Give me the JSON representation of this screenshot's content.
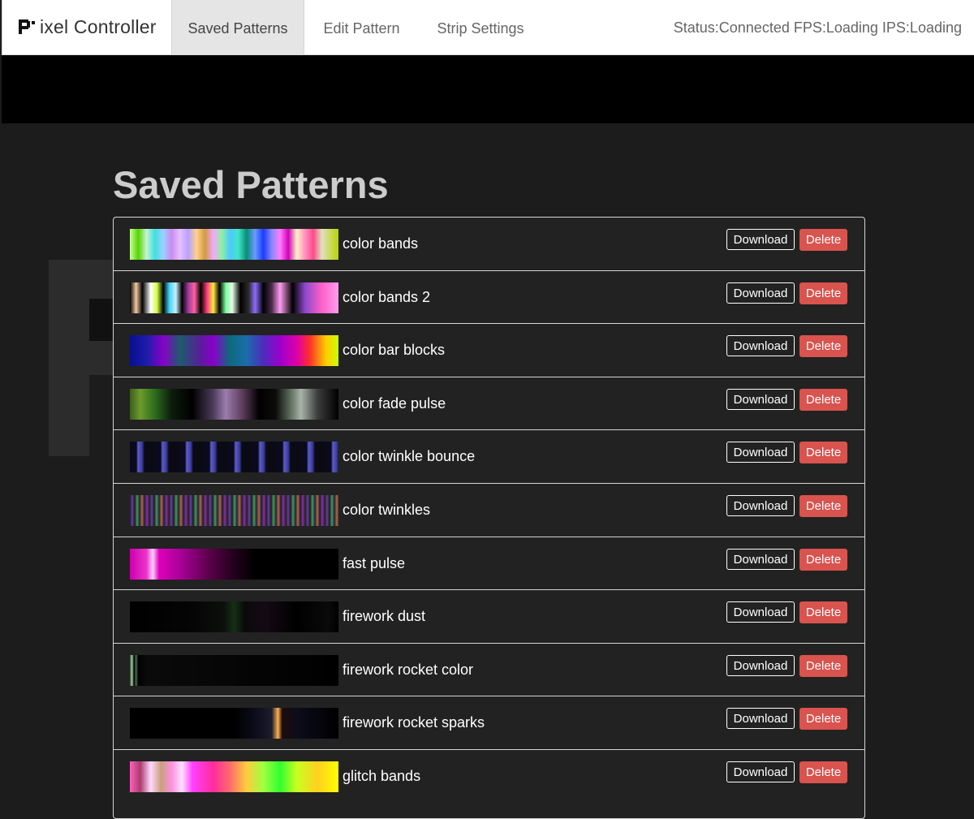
{
  "app": {
    "brand": "ixel Controller"
  },
  "nav": {
    "tabs": [
      {
        "label": "Saved Patterns"
      },
      {
        "label": "Edit Pattern"
      },
      {
        "label": "Strip Settings"
      }
    ],
    "status": "Status:Connected FPS:Loading IPS:Loading"
  },
  "page": {
    "title": "Saved Patterns"
  },
  "buttons": {
    "download": "Download",
    "delete": "Delete"
  },
  "colors": {
    "delete_button": "#d9534f",
    "background": "#1c1c1c",
    "list_background": "#222222"
  },
  "patterns": [
    {
      "name": "color bands",
      "gradient": "linear-gradient(to right,#c9ffa0 0%,#55d400 4%,#c7f4d2 8%,#3ee0e0 12%,#9dd1ff 16%,#c98cf0 20%,#e6c0ff 24%,#b8a0ff 28%,#ffd28a 32%,#d19b40 36%,#f4a7ff 40%,#90f0a0 44%,#50c8ff 48%,#40e6c6 52%,#0a8c7a 56%,#6a9cff 60%,#1c3cff 64%,#8888ff 68%,#ff7cff 72%,#d000b8 76%,#fff2c8 80%,#ff90c0 84%,#ff4a8a 88%,#e0e0c0 92%,#b8d400 100%)"
    },
    {
      "name": "color bands 2",
      "gradient": "linear-gradient(to right,#000 0%,#f2c8a0 3%,#000 6%,#fff 10%,#d0ff40 13%,#000 16%,#44d4ff 19%,#c8f0ff 22%,#000 25%,#9c3c9c 28%,#ff60a0 31%,#000 34%,#ff3c7c 37%,#ffea40 40%,#000 43%,#78ff9c 46%,#e8ffe8 49%,#000 53%,#2c2c2c 57%,#8c6cff 60%,#000 64%,#4c2c4c 68%,#ff9cf0 72%,#000 78%,#8c48cc 84%,#ff60c8 92%,#ff9cf0 100%)"
    },
    {
      "name": "color bar blocks",
      "gradient": "linear-gradient(to right,#08108c 0%,#1c1caa 8%,#8800c8 16%,#1c5c6c 24%,#5c1c9c 34%,#8800cc 40%,#0c6c7c 48%,#1c6cac 56%,#4c2cbc 64%,#9c00cc 72%,#dd00aa 80%,#ff2c2c 86%,#ffcc00 94%,#ccff00 100%)"
    },
    {
      "name": "color fade pulse",
      "gradient": "linear-gradient(to right,#3c5c1c 0%,#6c9c2c 5%,#2c6c1c 12%,#0c1c0c 20%,#000 30%,#4c3c5c 40%,#9c7cac 46%,#5c3c5c 54%,#000 62%,#0c0c0c 70%,#6c7c6c 78%,#aab4aa 82%,#3c3c3c 90%,#000 100%)"
    },
    {
      "name": "color twinkle bounce",
      "gradient": "repeating-linear-gradient(to right,#0a0a1c 0px,#0a0a1c 8px,#5c5ccc 10px,#3c3c9c 15px,#0a0a14 18px,#0a0a14 30px)"
    },
    {
      "name": "color twinkles",
      "gradient": "repeating-linear-gradient(to right,#1c1c2c 0px,#6c3c9c 3px,#1c1c1c 6px,#3c9c5c 9px,#2c1c3c 12px,#aa6c3c 15px,#1c1c3c 18px,#8c2c9c 21px,#1c2c1c 24px)"
    },
    {
      "name": "fast pulse",
      "gradient": "linear-gradient(to right,#cc00aa 0%,#ee33cc 8%,#ffd0ff 11%,#dd00bb 14%,#aa0099 24%,#660055 36%,#2a0022 48%,#000 60%,#000 100%)"
    },
    {
      "name": "firework dust",
      "gradient": "linear-gradient(to right,#000 0%,#050505 30%,#0c0f0c 45%,#143014 50%,#0a0a0a 55%,#140a14 65%,#000 80%,#0a0a0a 95%,#000 100%)"
    },
    {
      "name": "firework rocket color",
      "gradient": "linear-gradient(to right,#2c4c2c 0%,#aaccaa 1%,#000 2%,#4c6c4c 3%,#000 4%,#0a0a0a 8%,#000 100%)"
    },
    {
      "name": "firework rocket sparks",
      "gradient": "linear-gradient(to right,#000 0%,#000 50%,#0c0c1c 60%,#1c1c2c 68%,#ffb050 71%,#1c0c0c 73%,#0c0c1c 80%,#000 100%)"
    },
    {
      "name": "glitch bands",
      "gradient": "linear-gradient(to right,#ff60c0 0%,#aa3c6c 5%,#ffd8ff 10%,#c8a07c 15%,#ff90e0 20%,#ffe0ff 25%,#ff40ff 30%,#ff2c9c 40%,#ff6c6c 48%,#ffcc40 56%,#a0ff40 64%,#30ff30 72%,#c8ff20 80%,#ffd020 90%,#ffff00 100%)"
    }
  ]
}
